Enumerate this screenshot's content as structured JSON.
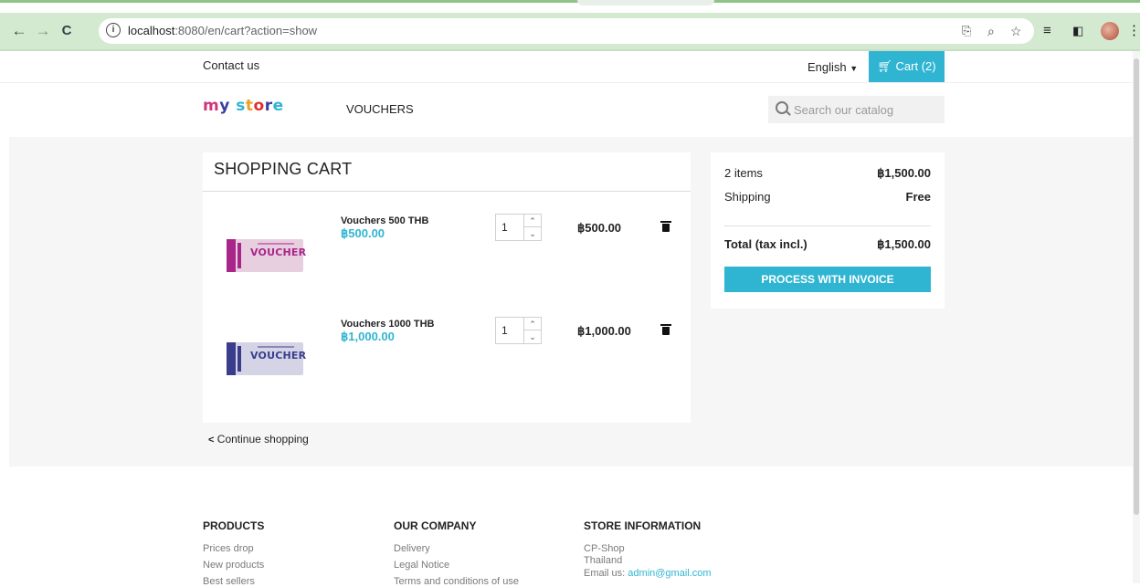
{
  "browser": {
    "url_host": "localhost",
    "url_path": ":8080/en/cart?action=show"
  },
  "header": {
    "contact": "Contact us",
    "language": "English",
    "cart_label": "Cart (2)",
    "logo": [
      "m",
      "y",
      " ",
      "s",
      "t",
      "o",
      "r",
      "e"
    ],
    "menu_vouchers": "VOUCHERS",
    "search_placeholder": "Search our catalog"
  },
  "cart": {
    "title": "SHOPPING CART",
    "items": [
      {
        "name": "Vouchers 500 THB",
        "price": "฿500.00",
        "qty": "1",
        "total": "฿500.00",
        "color": "#a8268a",
        "image_text": "VOUCHER"
      },
      {
        "name": "Vouchers 1000 THB",
        "price": "฿1,000.00",
        "qty": "1",
        "total": "฿1,000.00",
        "color": "#3a3d8c",
        "image_text": "VOUCHER"
      }
    ],
    "continue": "Continue shopping"
  },
  "summary": {
    "items_label": "2 items",
    "items_value": "฿1,500.00",
    "shipping_label": "Shipping",
    "shipping_value": "Free",
    "total_label": "Total (tax incl.)",
    "total_value": "฿1,500.00",
    "checkout": "PROCESS WITH INVOICE"
  },
  "footer": {
    "products": {
      "heading": "PRODUCTS",
      "links": [
        "Prices drop",
        "New products",
        "Best sellers"
      ]
    },
    "company": {
      "heading": "OUR COMPANY",
      "links": [
        "Delivery",
        "Legal Notice",
        "Terms and conditions of use"
      ]
    },
    "store": {
      "heading": "STORE INFORMATION",
      "lines": [
        "CP-Shop",
        "Thailand"
      ],
      "email_prefix": "Email us: ",
      "email": "admin@gmail.com"
    }
  },
  "colors": {
    "accent": "#2fb5d2",
    "chrome_green": "#d3ead0"
  }
}
